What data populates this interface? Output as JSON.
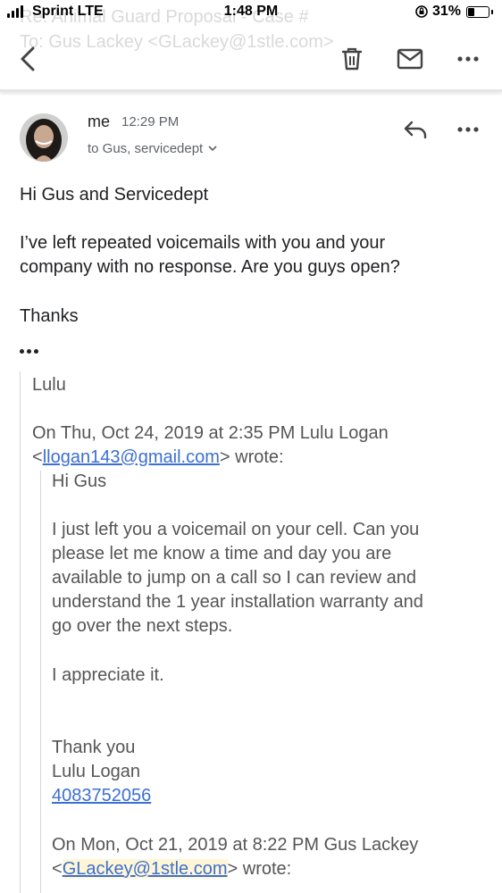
{
  "status_bar": {
    "carrier": "Sprint LTE",
    "time": "1:48 PM",
    "battery_percent": "31%",
    "battery_level": 0.31
  },
  "ghost_header": {
    "subject": "Re: Animal Guard Proposal - Case #",
    "to": "To: Gus Lackey <GLackey@1stle.com>"
  },
  "toolbar": {
    "back_icon": "chevron-left-icon",
    "delete_icon": "trash-icon",
    "mark_unread_icon": "envelope-icon",
    "more_icon": "more-horizontal-icon"
  },
  "message": {
    "sender": "me",
    "time": "12:29 PM",
    "recipients": "to Gus, servicedept",
    "body": {
      "greeting": "Hi Gus and Servicedept",
      "paragraph_lines": [
        "I’ve left repeated voicemails with you and your",
        "company with no response. Are you guys open?"
      ],
      "closing": "Thanks"
    }
  },
  "quoted": {
    "signoff": "Lulu",
    "attribution_line1": "On Thu, Oct 24, 2019 at 2:35 PM Lulu Logan",
    "attribution_email": "llogan143@gmail.com",
    "attribution_suffix": "wrote:",
    "nested": {
      "greeting": "Hi Gus",
      "paragraph_lines": [
        "I just left you a voicemail on your cell. Can you",
        "please let me know a time and day you are",
        "available to jump on a call so I can review and",
        "understand the 1 year installation warranty and",
        "go over the next steps."
      ],
      "appreciation": "I appreciate it.",
      "closing": "Thank you",
      "name": "Lulu Logan",
      "phone": "4083752056",
      "attribution_line1": "On Mon, Oct 21, 2019 at 8:22 PM Gus Lackey",
      "attribution_email": "GLackey@1stle.com",
      "attribution_suffix": "wrote:"
    }
  },
  "colors": {
    "link": "#3c6fd1",
    "quote_text": "#555555",
    "secondary_text": "#5f6368"
  }
}
